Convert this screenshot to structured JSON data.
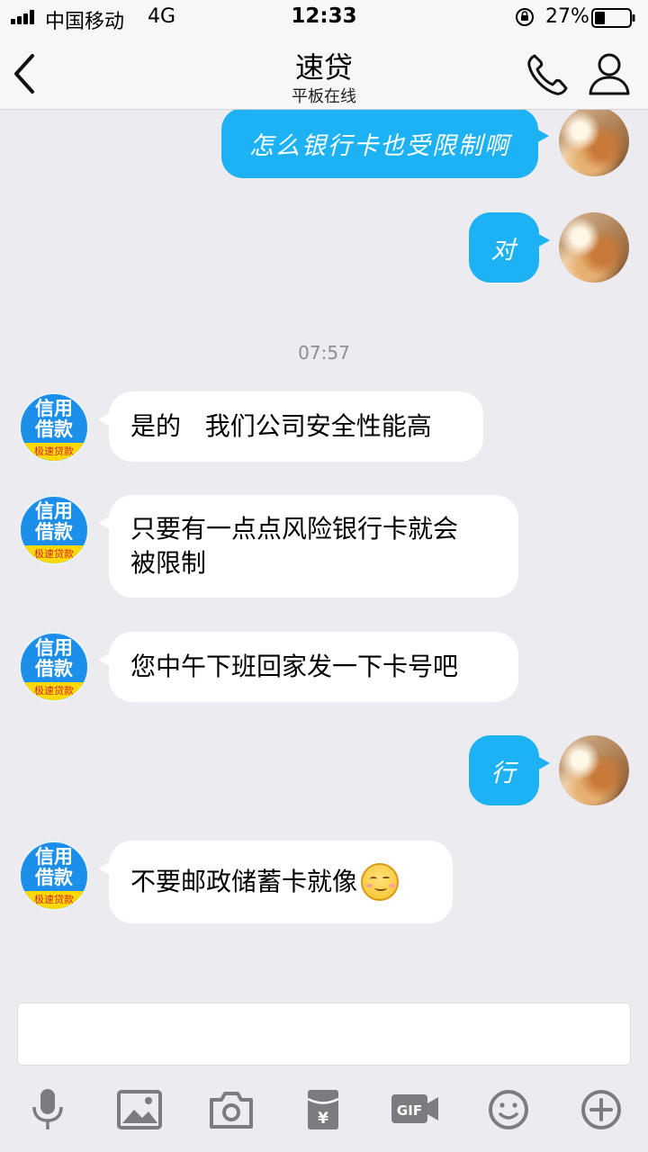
{
  "status_bar": {
    "carrier": "中国移动",
    "network": "4G",
    "time": "12:33",
    "battery": "27%"
  },
  "header": {
    "title": "速贷",
    "subtitle": "平板在线"
  },
  "messages": [
    {
      "from": "me",
      "text": "怎么银行卡也受限制啊"
    },
    {
      "from": "me",
      "text": "对"
    },
    {
      "type": "time",
      "text": "07:57"
    },
    {
      "from": "them",
      "text": "是的   我们公司安全性能高"
    },
    {
      "from": "them",
      "line1": "只要有一点点风险银行卡就会",
      "line2": "被限制"
    },
    {
      "from": "them",
      "text": "您中午下班回家发一下卡号吧"
    },
    {
      "from": "me",
      "text": "行"
    },
    {
      "from": "them",
      "text": "不要邮政储蓄卡就像",
      "emoji": "smiling-face-icon"
    }
  ],
  "bot_avatar": {
    "line1": "信用",
    "line2": "借款",
    "band": "极速贷款"
  },
  "toolbar": {
    "gif_label": "GIF",
    "items": [
      "microphone-icon",
      "image-icon",
      "camera-icon",
      "red-packet-icon",
      "gif-icon",
      "emoji-icon",
      "plus-icon"
    ]
  },
  "colors": {
    "accent": "#1db2f3",
    "background": "#ebebf0",
    "icon_gray": "#7c7c80"
  }
}
